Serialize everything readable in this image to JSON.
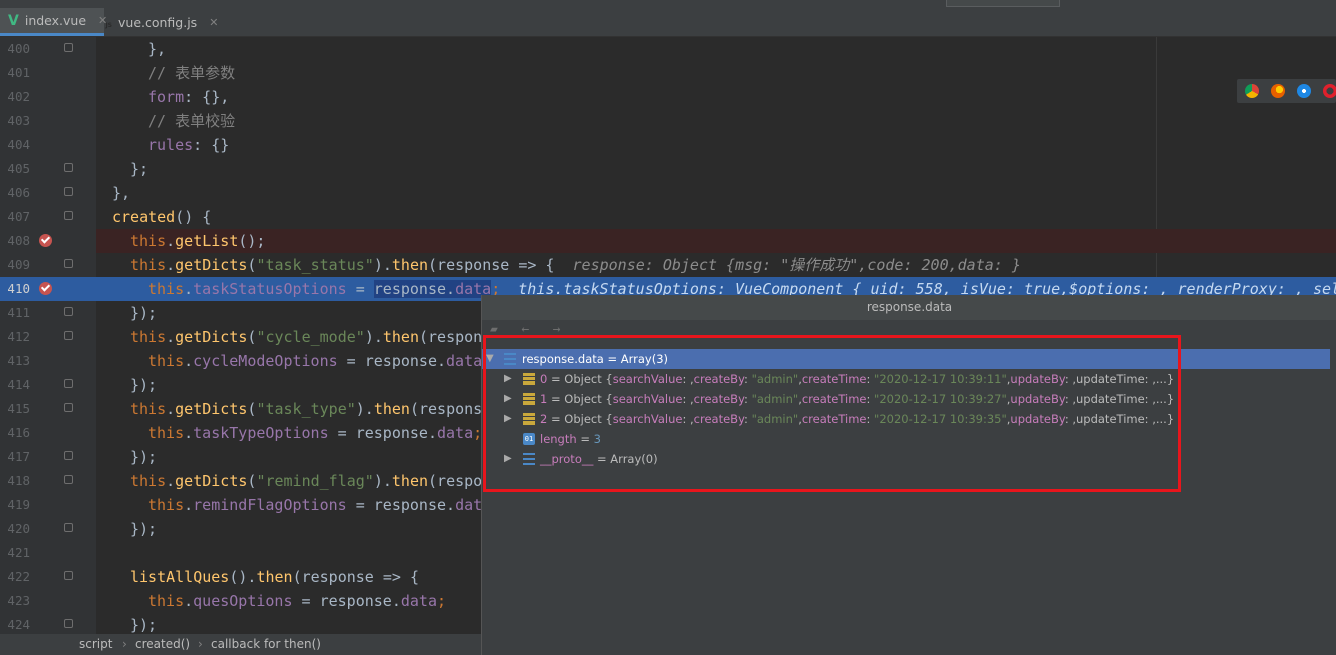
{
  "tabs": [
    {
      "label": "index.vue",
      "icon": "vue-icon",
      "active": true
    },
    {
      "label": "vue.config.js",
      "icon": "js-icon",
      "active": false
    }
  ],
  "line_numbers": [
    "400",
    "401",
    "402",
    "403",
    "404",
    "405",
    "406",
    "407",
    "408",
    "409",
    "410",
    "411",
    "412",
    "413",
    "414",
    "415",
    "416",
    "417",
    "418",
    "419",
    "420",
    "421",
    "422",
    "423",
    "424"
  ],
  "code": {
    "l400": "},",
    "l401": "// 表单参数",
    "l402_a": "form",
    "l402_b": ": {},",
    "l403": "// 表单校验",
    "l404_a": "rules",
    "l404_b": ": {}",
    "l405": "};",
    "l406": "},",
    "l407_a": "created",
    "l407_b": "() {",
    "this": "this",
    "then": "then",
    "getList": "getList",
    "getDicts": "getDicts",
    "data": "data",
    "l408_tail": "();",
    "l409_str": "\"task_status\"",
    "l409_tail": "(response => {",
    "l409_inline": "response: Object {msg: \"操作成功\",code: 200,data: }",
    "l410_prop": "taskStatusOptions",
    "l410_mid": " = ",
    "l410_sel": "response.",
    "l410_inline": "this.taskStatusOptions: VueComponent {_uid: 558,_isVue: true,$options: ,_renderProxy: ,_self",
    "close": "});",
    "l412_str": "\"cycle_mode\"",
    "l412_tail": "(respon",
    "l413_prop": "cycleModeOptions",
    "l413_tail": " = response.",
    "l413_data": "data",
    "l415_str": "\"task_type\"",
    "l415_tail": "(respons",
    "l416_prop": "taskTypeOptions",
    "l416_tail": " = response.",
    "l418_str": "\"remind_flag\"",
    "l418_tail": "(respo",
    "l419_prop": "remindFlagOptions",
    "l419_tail": " = response.",
    "l419_data": "dat",
    "l422_fn": "listAllQues",
    "l422_tail": "(response => {",
    "l423_prop": "quesOptions",
    "l423_tail": " = response.",
    "semi": ";"
  },
  "popup": {
    "title": "response.data",
    "root": {
      "name": "response.data",
      "value": "= Array(3)"
    },
    "items": [
      {
        "index": "0",
        "type": "= Object {",
        "k1": "searchValue",
        "v1": ": ,",
        "k2": "createBy",
        "v2": "\"admin\"",
        "k3": "createTime",
        "v3": "\"2020-12-17 10:39:11\"",
        "k4": "updateBy",
        "rest": ": ,updateTime: ,...}"
      },
      {
        "index": "1",
        "type": "= Object {",
        "k1": "searchValue",
        "v1": ": ,",
        "k2": "createBy",
        "v2": "\"admin\"",
        "k3": "createTime",
        "v3": "\"2020-12-17 10:39:27\"",
        "k4": "updateBy",
        "rest": ": ,updateTime: ,...}"
      },
      {
        "index": "2",
        "type": "= Object {",
        "k1": "searchValue",
        "v1": ": ,",
        "k2": "createBy",
        "v2": "\"admin\"",
        "k3": "createTime",
        "v3": "\"2020-12-17 10:39:35\"",
        "k4": "updateBy",
        "rest": ": ,updateTime: ,...}"
      }
    ],
    "length": {
      "name": "length",
      "eq": "=",
      "value": "3"
    },
    "proto": {
      "name": "__proto__",
      "value": "= Array(0)"
    }
  },
  "breadcrumb": [
    "script",
    "created()",
    "callback for then()"
  ],
  "colors": {
    "highlight_box": "#e8151c",
    "exec_line": "#2d5ca0",
    "breakpoint": "#c75450"
  }
}
